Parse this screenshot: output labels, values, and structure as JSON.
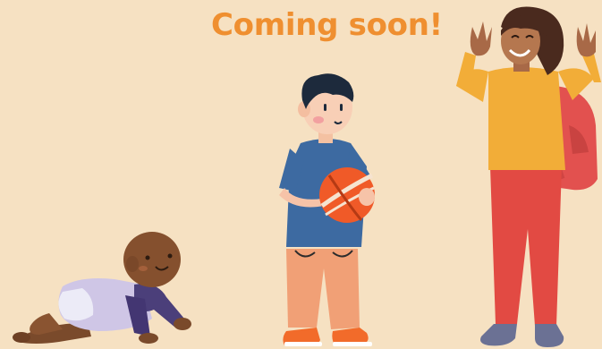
{
  "headline": "Coming soon!",
  "colors": {
    "background": "#f6e1c2",
    "headline": "#ef8f30"
  },
  "illustration": {
    "figures": [
      "crawling-baby",
      "boy-holding-ball",
      "girl-with-backpack-waving"
    ]
  }
}
